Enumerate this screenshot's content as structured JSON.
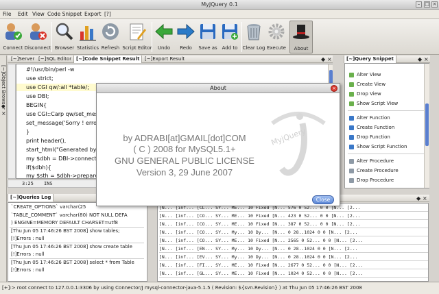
{
  "window": {
    "title": "MyJQuery 0.1"
  },
  "menu": [
    "File",
    "Edit",
    "View",
    "Code Snippet",
    "Export",
    "[?]"
  ],
  "toolbar": [
    {
      "label": "Connect",
      "icon": "connect-icon"
    },
    {
      "label": "Disconnect",
      "icon": "disconnect-icon"
    },
    {
      "label": "Browser",
      "icon": "magnifier-icon"
    },
    {
      "label": "Statistics",
      "icon": "bar-chart-icon"
    },
    {
      "label": "Refresh",
      "icon": "refresh-icon"
    },
    {
      "label": "Script Editor",
      "icon": "edit-icon"
    },
    {
      "label": "Undo",
      "icon": "arrow-left-icon"
    },
    {
      "label": "Redo",
      "icon": "arrow-right-icon"
    },
    {
      "label": "Save as",
      "icon": "floppy-icon"
    },
    {
      "label": "Add to",
      "icon": "floppy-add-icon"
    },
    {
      "label": "Clear Log",
      "icon": "trash-icon"
    },
    {
      "label": "Execute",
      "icon": "gear-icon"
    },
    {
      "label": "About",
      "icon": "top-hat-icon"
    }
  ],
  "left_panel": {
    "label": "Object Browser",
    "marker": "[~]"
  },
  "tabs": [
    "[~]Server",
    "[~]SQL Editor",
    "[~]Code Snippet Result",
    "[~]Export Result"
  ],
  "code_lines": [
    "#!/usr/bin/perl -w",
    "use strict;",
    "use CGI qw/:all *table/;",
    "use DBI;",
    "BEGIN{",
    "use CGI::Carp qw/set_mes",
    "set_message('Sorry ! erro",
    "}",
    "print header(),",
    "start_html(\"Generated by",
    "my $dbh = DBI->connect(\"",
    "if($dbh){",
    "my $sth  = $dbh->prepare"
  ],
  "editor_status": {
    "position": "3:25",
    "mode": "INS"
  },
  "snippet_panel": {
    "title": "[~]Query Snippet",
    "items": [
      "Alter View",
      "Create View",
      "Drop View",
      "Show Script View",
      "Alter Function",
      "Create Function",
      "Drop Function",
      "Show Script Function",
      "Alter Procedure",
      "Create Procedure",
      "Drop Procedure"
    ]
  },
  "queries_log": {
    "title": "[~]Queries Log",
    "lines": [
      "`CREATE_OPTIONS` varchar(25",
      "`TABLE_COMMENT` varchar(80) NOT NULL DEFA",
      ") ENGINE=MEMORY DEFAULT CHARSET=utf8",
      "[Thu Jun 05 17:46:26 BST 2008] show tables;",
      "[!]Errors : null",
      "[Thu Jun 05 17:46:26 BST 2008] show create table",
      "[!]Errors : null",
      "[Thu Jun 05 17:46:26 BST 2008] select * from Table",
      "[!]Errors : null"
    ]
  },
  "result_grid": {
    "rows": [
      "[N... [inf... [CL... SY... ME... 10 Fixed [N... 576  0   52... 0  0  [N... [2...",
      "[N... [inf... [CO... SY... ME... 10 Fixed [N... 423  0   52... 0  0  [N... [2...",
      "[N... [inf... [CO... SY... ME... 10 Fixed [N... 387  0   52... 0  0  [N... [2...",
      "[N... [inf... [CO... SY... My... 10 Dy... [N... 0    28..1024 0  0  [N... [2...",
      "[N... [inf... [CO... SY... ME... 10 Fixed [N... 2565 0   52... 0  0  [N... [2...",
      "[N... [inf... [EN... SY... My... 10 Dy... [N... 0    28..1024 0  0  [N... [2...",
      "[N... [inf... [EV... SY... My... 10 Dy... [N... 0    28..1024 0  0  [N... [2...",
      "[N... [inf... [FI... SY... ME... 10 Fixed [N... 2677 0   52... 0  0  [N... [2...",
      "[N... [inf... [GL... SY... ME... 10 Fixed [N... 1024 0   52... 0  0  [N... [2..."
    ]
  },
  "about_dialog": {
    "title": "About",
    "lines": [
      "by ADRABI[at]GMAIL[dot]COM",
      "( C ) 2008 for MySQL5.1+",
      "GNU GENERAL PUBLIC LICENSE",
      "Version 3, 29 June 2007"
    ],
    "logo_text": "MyjQuery",
    "close_label": "Close"
  },
  "status_bar": "[+]:> root connect to 127.0.0.1:3306 by using Connector/J mysql-connector-java-5.1.5 ( Revision: ${svn.Revision} ) at Thu Jun 05 17:46:26 BST 2008",
  "colors": {
    "accent": "#5a7fcf",
    "snippet_dot": "#6ab04c",
    "close_red": "#d9362b"
  }
}
